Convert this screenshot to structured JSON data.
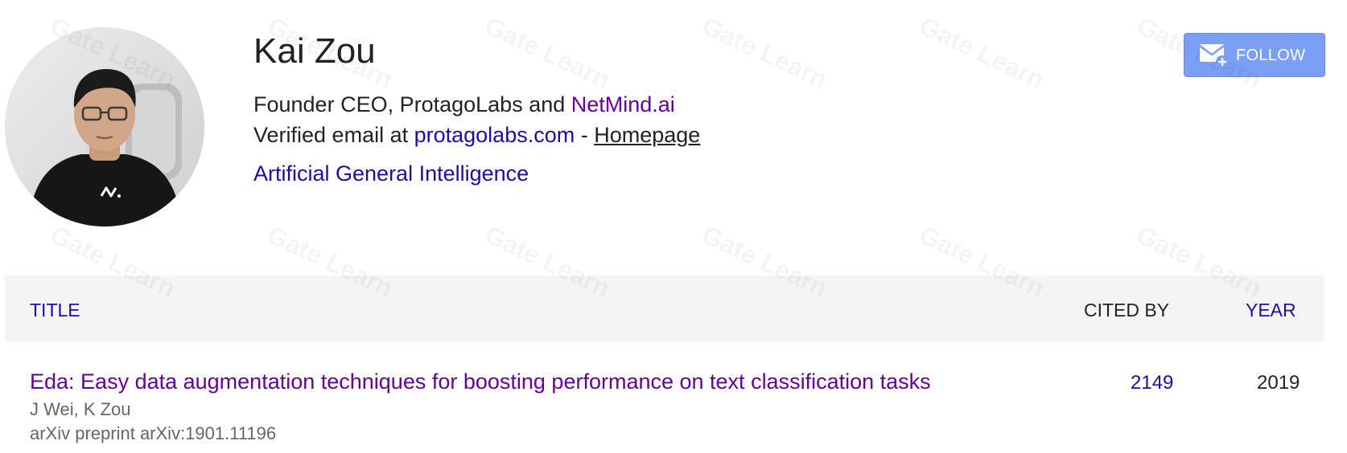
{
  "profile": {
    "name": "Kai Zou",
    "affiliation_prefix": "Founder CEO, ProtagoLabs and ",
    "affiliation_link": "NetMind.ai",
    "email_prefix": "Verified email at ",
    "email_domain": "protagolabs.com",
    "email_separator": " - ",
    "homepage_label": "Homepage",
    "interest": "Artificial General Intelligence",
    "avatar_icon": "profile-photo"
  },
  "follow": {
    "label": "FOLLOW",
    "icon": "mail-plus-icon",
    "color": "#7b9ff5"
  },
  "table": {
    "columns": {
      "title": "TITLE",
      "cited_by": "CITED BY",
      "year": "YEAR"
    },
    "rows": [
      {
        "title": "Eda: Easy data augmentation techniques for boosting performance on text classification tasks",
        "authors": "J Wei, K Zou",
        "venue": "arXiv preprint arXiv:1901.11196",
        "cited_by": "2149",
        "year": "2019"
      }
    ]
  },
  "watermark": {
    "text": "Gate Learn"
  },
  "colors": {
    "link_blue": "#1a0dab",
    "link_visited": "#660099",
    "text": "#222222",
    "muted": "#666666",
    "header_bg": "#f4f4f4"
  }
}
